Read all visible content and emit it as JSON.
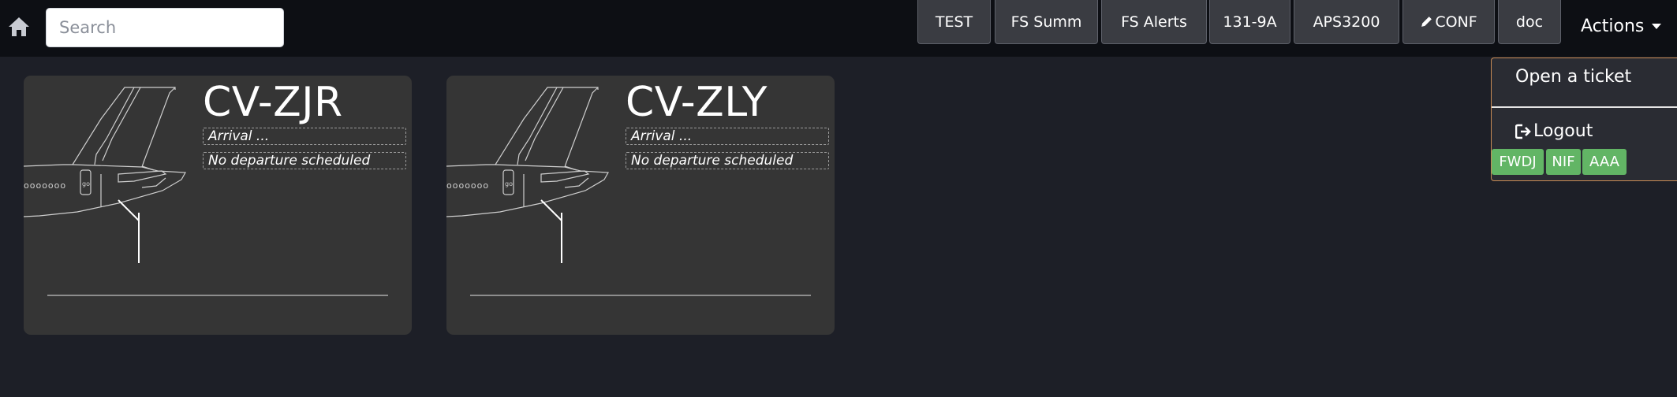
{
  "search": {
    "placeholder": "Search"
  },
  "nav_buttons": [
    "TEST",
    "FS Summ",
    "FS Alerts",
    "131-9A",
    "APS3200",
    "CONF",
    "doc"
  ],
  "actions": {
    "label": "Actions",
    "menu": {
      "open_ticket": "Open a ticket",
      "logout": "Logout"
    },
    "tags": [
      "FWDJ",
      "NIF",
      "AAA"
    ]
  },
  "aircraft": [
    {
      "registration": "CV-ZJR",
      "arrival": "Arrival ...",
      "departure": "No departure scheduled"
    },
    {
      "registration": "CV-ZLY",
      "arrival": "Arrival ...",
      "departure": "No departure scheduled"
    }
  ],
  "colors": {
    "background": "#1d1f27",
    "topbar": "#0d0f14",
    "card": "#353535",
    "tag": "#62b565",
    "dropdown_border": "#c98c55"
  },
  "icons": {
    "home": "home-icon",
    "edit": "pencil-icon",
    "logout": "logout-icon",
    "caret": "caret-down-icon"
  }
}
